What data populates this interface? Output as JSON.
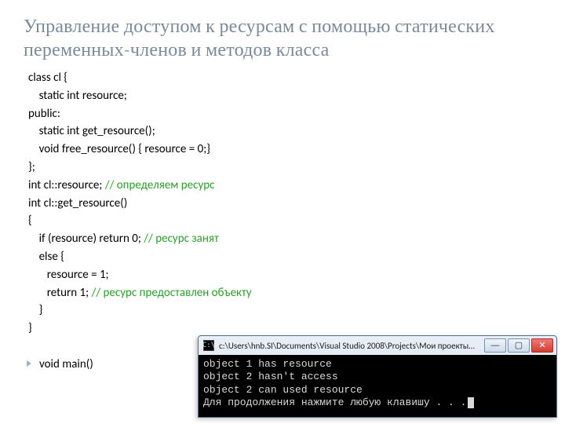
{
  "title": "Управление доступом к ресурсам с помощью статических переменных-членов и методов класса",
  "code": {
    "l1": "class cl {",
    "l2": "    static int resource;",
    "l3": "public:",
    "l4": "    static int get_resource();",
    "l5": "    void free_resource() { resource = 0;}",
    "l6": "};",
    "l7": "int cl::resource; ",
    "c7": "// определяем ресурс",
    "l8": "int cl::get_resource()",
    "l9": "{",
    "l10": "    if (resource) return 0; ",
    "c10": "// ресурс занят",
    "l11": "    else {",
    "l12": "       resource = 1;",
    "l13": "       return 1; ",
    "c13": "// ресурс предоставлен объекту",
    "l14": "    }",
    "l15": "}",
    "l17": "void main()"
  },
  "console": {
    "title": "c:\\Users\\hnb.SI\\Documents\\Visual Studio 2008\\Projects\\Мои проекты\\Debug\\Проект...",
    "lines": {
      "o1": "object 1 has resource",
      "o2": "object 2 hasn't access",
      "o3": "object 2 can used resource",
      "o4": "Для продолжения нажмите любую клавишу . . ."
    },
    "btn_min": "—",
    "btn_max": "▢",
    "btn_close": "✕",
    "icon_glyph": "C:\\"
  }
}
